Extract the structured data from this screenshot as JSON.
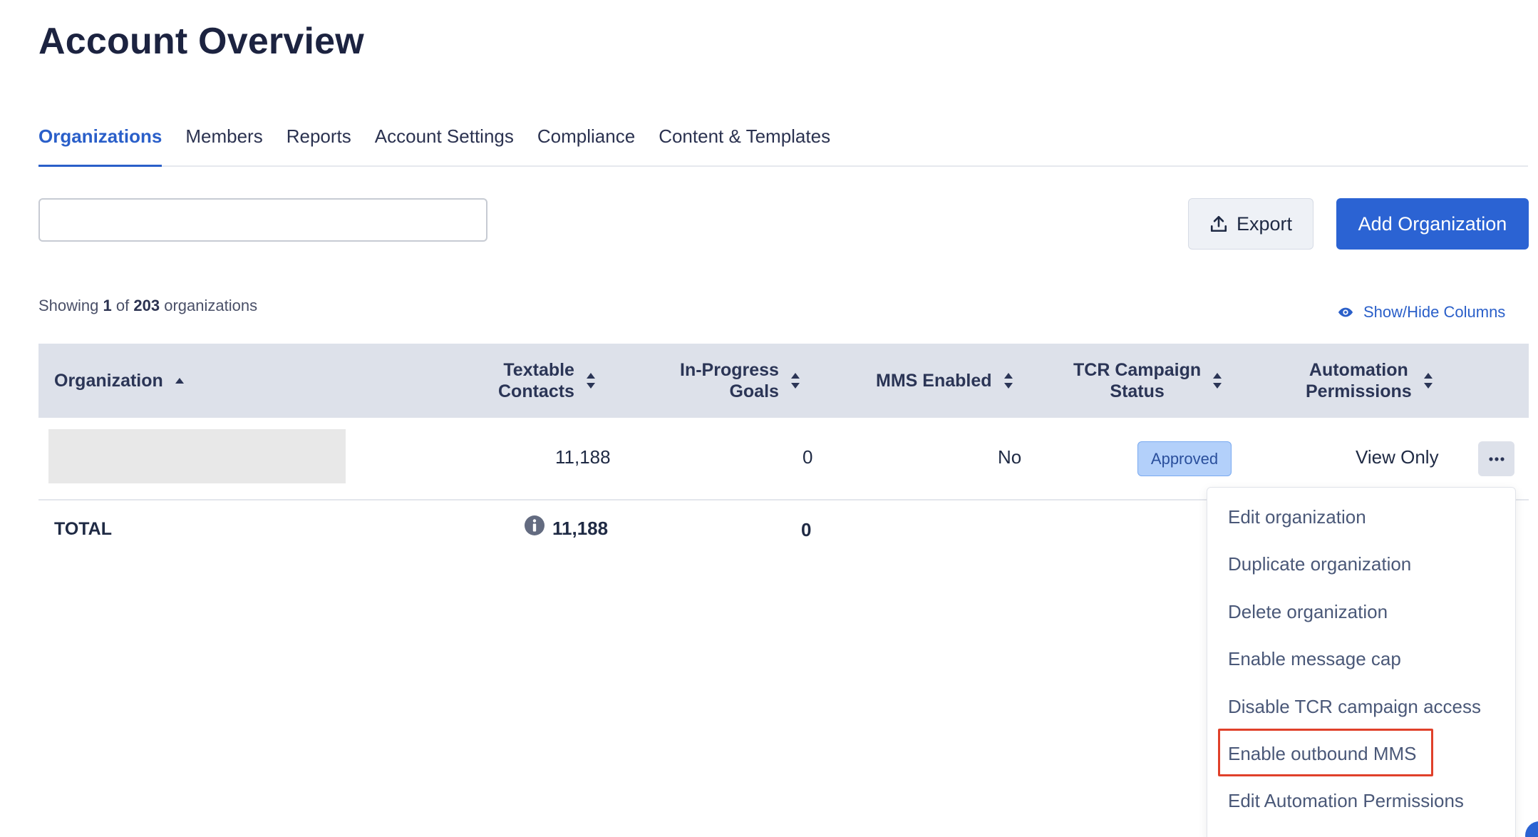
{
  "page": {
    "title": "Account Overview"
  },
  "tabs": [
    {
      "label": "Organizations",
      "active": true
    },
    {
      "label": "Members",
      "active": false
    },
    {
      "label": "Reports",
      "active": false
    },
    {
      "label": "Account Settings",
      "active": false
    },
    {
      "label": "Compliance",
      "active": false
    },
    {
      "label": "Content & Templates",
      "active": false
    }
  ],
  "search": {
    "value": "",
    "placeholder": ""
  },
  "toolbar": {
    "export_label": "Export",
    "add_label": "Add Organization"
  },
  "summary": {
    "prefix": "Showing",
    "shown": "1",
    "of": "of",
    "total": "203",
    "suffix": "organizations"
  },
  "columns_toggle": {
    "label": "Show/Hide Columns"
  },
  "table": {
    "headers": {
      "organization": "Organization",
      "textable_1": "Textable",
      "textable_2": "Contacts",
      "goals_1": "In-Progress",
      "goals_2": "Goals",
      "mms": "MMS Enabled",
      "tcr_1": "TCR Campaign",
      "tcr_2": "Status",
      "auto_1": "Automation",
      "auto_2": "Permissions"
    },
    "rows": [
      {
        "organization": "",
        "textable_contacts": "11,188",
        "in_progress_goals": "0",
        "mms_enabled": "No",
        "tcr_status": "Approved",
        "automation_permissions": "View Only"
      }
    ],
    "total": {
      "label": "TOTAL",
      "textable_contacts": "11,188",
      "in_progress_goals": "0"
    }
  },
  "menu": {
    "items": [
      "Edit organization",
      "Duplicate organization",
      "Delete organization",
      "Enable message cap",
      "Disable TCR campaign access",
      "Enable outbound MMS",
      "Edit Automation Permissions"
    ],
    "highlighted_index": 5
  },
  "colors": {
    "accent": "#2b63d3",
    "active_tab": "#2a5fc9",
    "header_bg": "#dde1ea",
    "badge_bg": "#b3d0fa",
    "highlight": "#e0402a"
  },
  "icons": {
    "export": "upload-icon",
    "columns": "eye-icon",
    "sort": "sort-icon",
    "sort_asc": "sort-asc-icon",
    "info": "info-icon",
    "actions": "more-horizontal-icon"
  }
}
